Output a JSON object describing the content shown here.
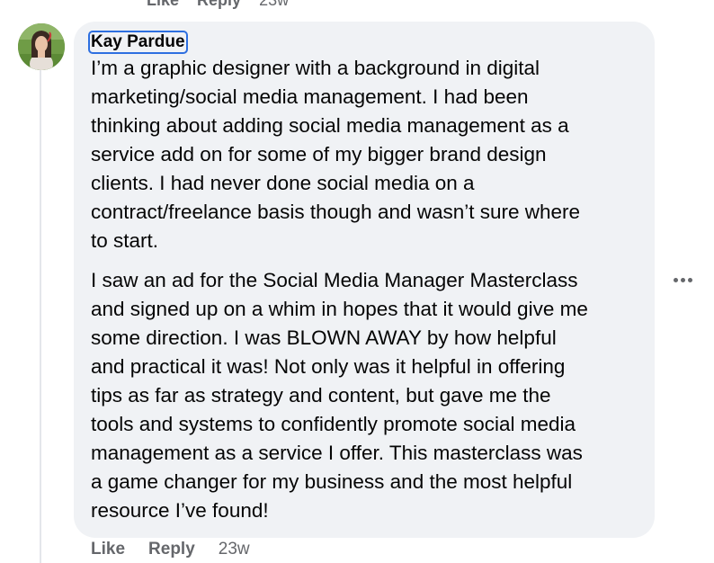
{
  "previous_comment_actions": {
    "like": "Like",
    "reply": "Reply",
    "time": "23w"
  },
  "comment": {
    "author": "Kay Pardue",
    "paragraphs": [
      {
        "lines": [
          "I’m a graphic designer with a background in digital",
          "marketing/social media management. I had been",
          "thinking about adding social media management as a",
          "service add on for some of my bigger brand design",
          "clients. I had never done social media on a",
          "contract/freelance basis though and wasn’t sure where",
          "to start."
        ]
      },
      {
        "lines": [
          "I saw an ad for the Social Media Manager Masterclass",
          "and signed up on a whim in hopes that it would give me",
          "some direction. I was BLOWN AWAY by how helpful",
          "and practical it was! Not only was it helpful in offering",
          "tips as far as strategy and content, but gave me the",
          "tools and systems to confidently promote social media",
          "management as a service I offer. This masterclass was",
          "a game changer for my business and the most helpful",
          "resource I’ve found!"
        ]
      }
    ],
    "actions": {
      "like": "Like",
      "reply": "Reply",
      "time": "23w"
    },
    "more_icon": "more-horizontal-icon"
  },
  "colors": {
    "bubble": "#f0f2f5",
    "text": "#050505",
    "secondary": "#65676b",
    "focus_outline": "#2d6fe0"
  }
}
